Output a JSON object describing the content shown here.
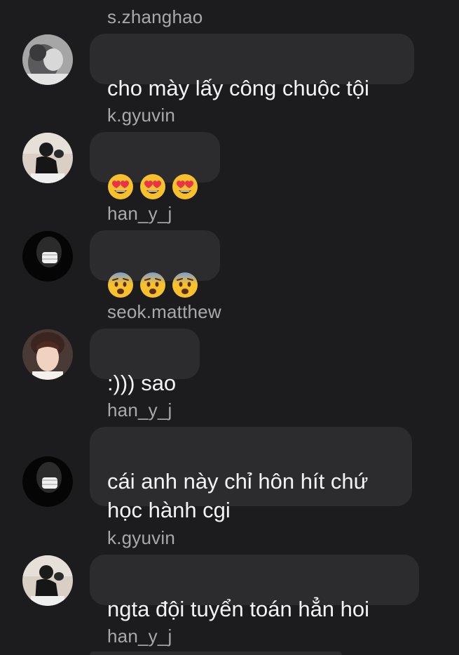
{
  "messages": [
    {
      "sender": "s.zhanghao",
      "avatar_icon": "avatar-zhanghao",
      "text": "cho mày lấy công chuộc tội"
    },
    {
      "sender": "k.gyuvin",
      "avatar_icon": "avatar-gyuvin",
      "emoji": [
        "heart-eyes-emoji",
        "heart-eyes-emoji",
        "heart-eyes-emoji"
      ]
    },
    {
      "sender": "han_y_j",
      "avatar_icon": "avatar-han-y-j",
      "emoji": [
        "fearful-face-emoji",
        "fearful-face-emoji",
        "fearful-face-emoji"
      ]
    },
    {
      "sender": "seok.matthew",
      "avatar_icon": "avatar-matthew",
      "text": ":))) sao"
    },
    {
      "sender": "han_y_j",
      "avatar_icon": "avatar-han-y-j",
      "text": "cái anh này chỉ hôn hít chứ\nhọc hành cgi"
    },
    {
      "sender": "k.gyuvin",
      "avatar_icon": "avatar-gyuvin",
      "text": "ngta đội tuyển toán hẳn hoi"
    },
    {
      "sender": "han_y_j"
    }
  ],
  "colors": {
    "background": "#1c1c1e",
    "bubble": "#2c2c2e",
    "sender_text": "#a8a8ad",
    "message_text": "#f2f2f7"
  }
}
